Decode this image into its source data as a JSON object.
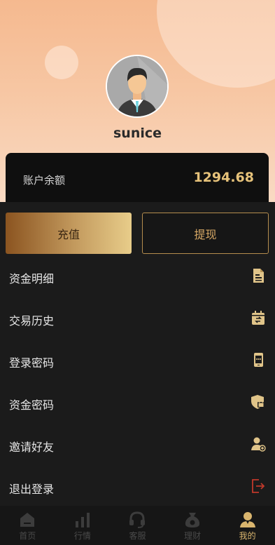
{
  "user": {
    "name": "sunice"
  },
  "balance": {
    "label": "账户余额",
    "value": "1294.68"
  },
  "actions": {
    "recharge": "充值",
    "withdraw": "提现"
  },
  "menu": [
    {
      "label": "资金明细",
      "icon": "document-icon"
    },
    {
      "label": "交易历史",
      "icon": "calendar-icon"
    },
    {
      "label": "登录密码",
      "icon": "phone-lock-icon"
    },
    {
      "label": "资金密码",
      "icon": "shield-lock-icon"
    },
    {
      "label": "邀请好友",
      "icon": "add-user-icon"
    },
    {
      "label": "退出登录",
      "icon": "logout-icon"
    }
  ],
  "tabs": [
    {
      "label": "首页",
      "icon": "home-icon"
    },
    {
      "label": "行情",
      "icon": "chart-icon"
    },
    {
      "label": "客服",
      "icon": "headset-icon"
    },
    {
      "label": "理财",
      "icon": "money-bag-icon"
    },
    {
      "label": "我的",
      "icon": "user-icon",
      "active": true
    }
  ],
  "colors": {
    "accent": "#d9b56e",
    "background": "#1b1b1b",
    "header": "#f5b98f",
    "logout": "#c0392b"
  }
}
